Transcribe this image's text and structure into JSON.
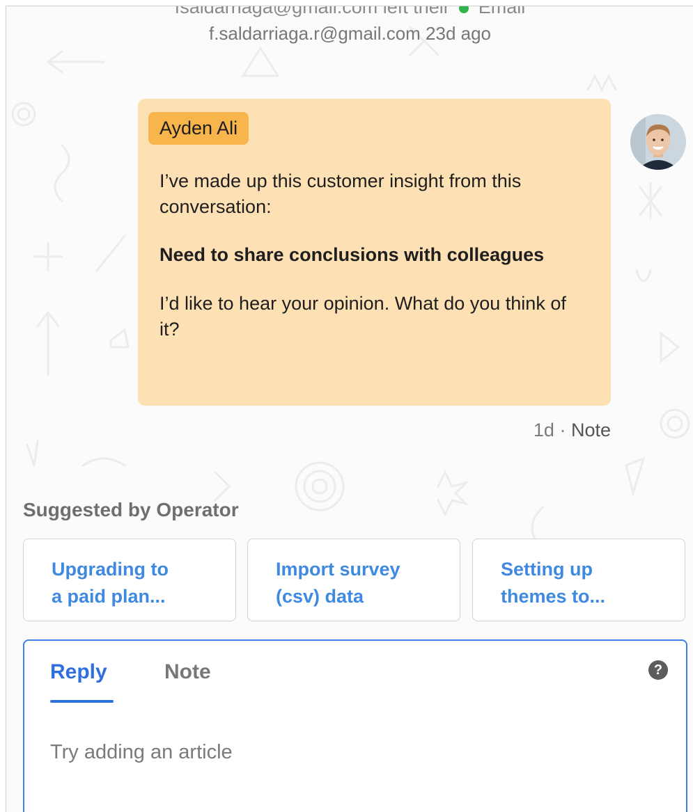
{
  "previous_message": {
    "partial_line_text": "fsaldarriaga@gmail.com left their",
    "channel_label": "Email",
    "channel_color": "#2fb34a",
    "meta_line": "f.saldarriaga.r@gmail.com 23d ago"
  },
  "note": {
    "author": "Ayden Ali",
    "paragraph_1": "I’ve made up this customer insight from this conversation:",
    "insight": "Need to share conclusions with colleagues",
    "paragraph_3": "I’d like to hear your opinion. What do you think of it?",
    "time": "1d",
    "separator": " · ",
    "type_label": "Note",
    "bubble_color": "#fde1b4",
    "tag_color": "#f8b54b"
  },
  "suggestions": {
    "heading": "Suggested by Operator",
    "items": [
      {
        "line1": "Upgrading to",
        "line2": "a paid plan..."
      },
      {
        "line1": "Import survey",
        "line2": "(csv) data"
      },
      {
        "line1": "Setting up",
        "line2": "themes to..."
      }
    ]
  },
  "composer": {
    "tabs": [
      {
        "label": "Reply",
        "active": true
      },
      {
        "label": "Note",
        "active": false
      }
    ],
    "help_icon": "?",
    "placeholder": "Try adding an article",
    "accent_color": "#2f6fe0"
  }
}
